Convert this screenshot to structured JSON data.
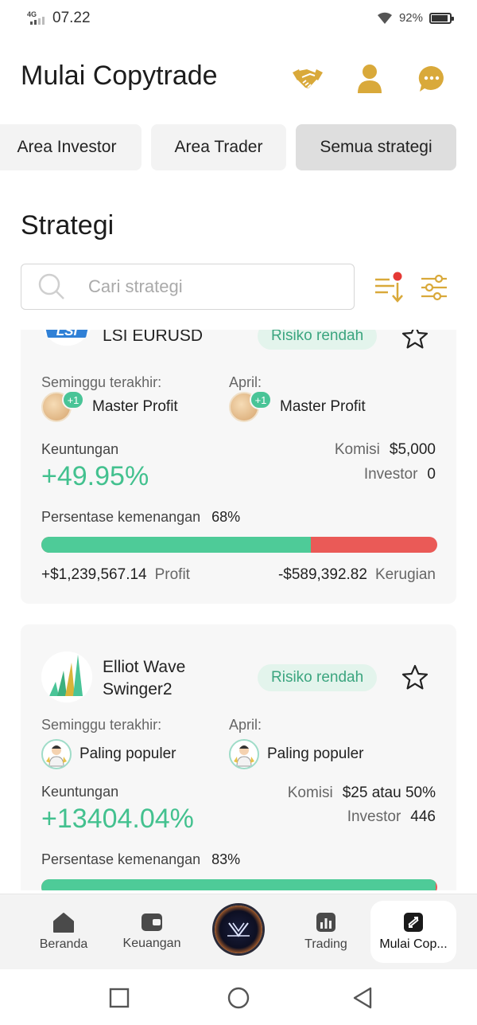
{
  "status_bar": {
    "network": "4G",
    "time": "07.22",
    "battery": "92%",
    "battery_level": 0.92
  },
  "header": {
    "title": "Mulai Copytrade",
    "icons": [
      "handshake-icon",
      "profile-icon",
      "chat-icon"
    ]
  },
  "tabs": [
    {
      "label": "Area Investor",
      "active": false
    },
    {
      "label": "Area Trader",
      "active": false
    },
    {
      "label": "Semua strategi",
      "active": true
    }
  ],
  "section_title": "Strategi",
  "search": {
    "placeholder": "Cari strategi",
    "value": ""
  },
  "strategies": [
    {
      "name": "LSI EURUSD",
      "avatar_text": "LSI",
      "risk": "Risiko rendah",
      "week_label": "Seminggu terakhir:",
      "week_badge": "Master Profit",
      "week_badge_extra": "+1",
      "month_label": "April:",
      "month_badge": "Master Profit",
      "month_badge_extra": "+1",
      "profit_label": "Keuntungan",
      "profit_pct": "+49.95%",
      "commission_label": "Komisi",
      "commission": "$5,000",
      "investor_label": "Investor",
      "investors": "0",
      "winrate_label": "Persentase kemenangan",
      "winrate": "68%",
      "winrate_value": 0.68,
      "profit_amount": "+$1,239,567.14",
      "profit_text": "Profit",
      "loss_amount": "-$589,392.82",
      "loss_text": "Kerugian"
    },
    {
      "name": "Elliot Wave Swinger2",
      "risk": "Risiko rendah",
      "week_label": "Seminggu terakhir:",
      "week_badge": "Paling populer",
      "month_label": "April:",
      "month_badge": "Paling populer",
      "profit_label": "Keuntungan",
      "profit_pct": "+13404.04%",
      "commission_label": "Komisi",
      "commission": "$25 atau 50%",
      "investor_label": "Investor",
      "investors": "446",
      "winrate_label": "Persentase kemenangan",
      "winrate": "83%",
      "winrate_value": 0.995
    }
  ],
  "bottom_nav": [
    {
      "label": "Beranda",
      "icon": "home-icon"
    },
    {
      "label": "Keuangan",
      "icon": "wallet-icon"
    },
    {
      "label": "",
      "icon": "app-logo-icon"
    },
    {
      "label": "Trading",
      "icon": "chart-icon"
    },
    {
      "label": "Mulai Cop...",
      "icon": "copytrade-icon",
      "active": true
    }
  ],
  "colors": {
    "accent_gold": "#d9a93a",
    "profit_green": "#43c18f",
    "win_bar": "#4ecb98",
    "loss_bar": "#ea5a57",
    "risk_badge_bg": "#e3f4ec"
  }
}
